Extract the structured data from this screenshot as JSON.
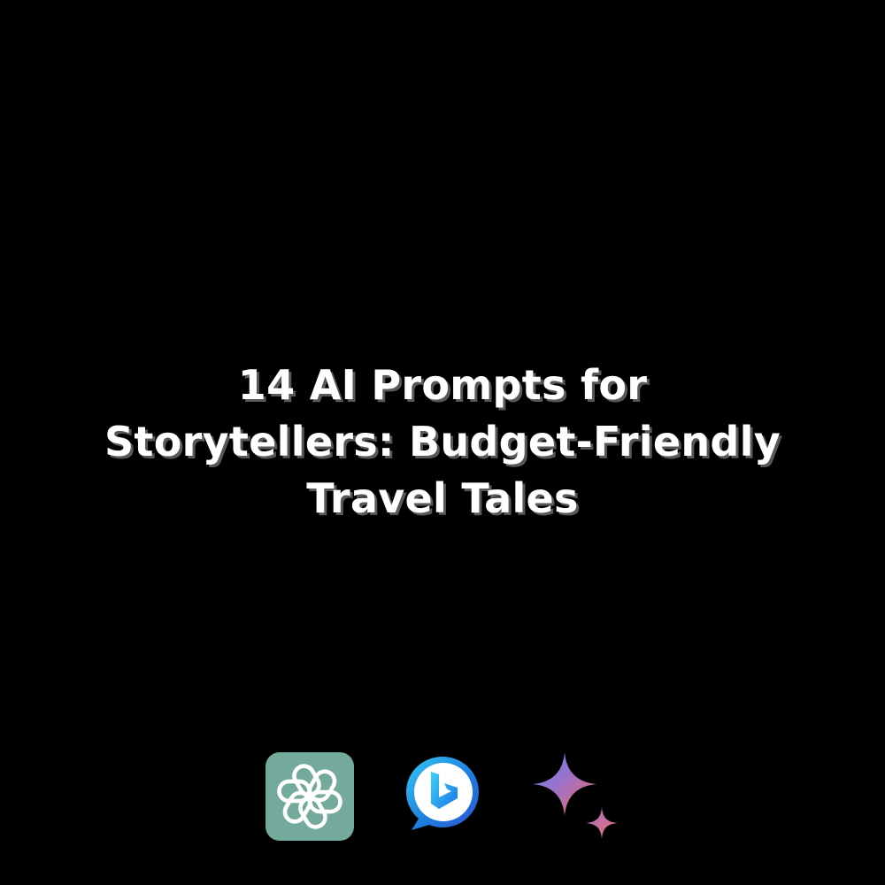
{
  "title": {
    "line1": "14 AI Prompts for",
    "line2": "Storytellers: Budget-Friendly",
    "line3": "Travel Tales"
  },
  "logos": [
    {
      "name": "chatgpt-icon",
      "color": "#74aa9c"
    },
    {
      "name": "bing-icon",
      "color": "#1b7fe0"
    },
    {
      "name": "gemini-icon",
      "color": "#d96570"
    }
  ],
  "colors": {
    "background": "#000000",
    "title_text": "#ffffff"
  }
}
